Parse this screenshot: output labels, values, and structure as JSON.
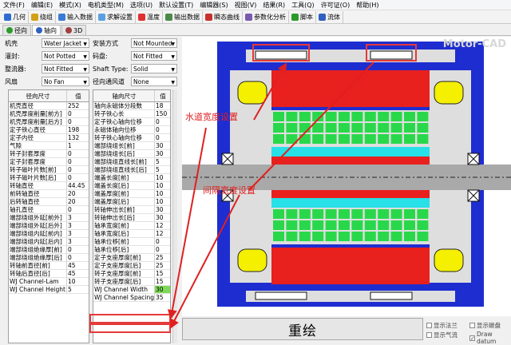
{
  "menu": [
    "文件(F)",
    "编辑(E)",
    "模式(X)",
    "电机类型(M)",
    "选项(U)",
    "默认设置(T)",
    "编辑器(S)",
    "视图(V)",
    "结果(R)",
    "工具(Q)",
    "许可证(O)",
    "帮助(H)"
  ],
  "toolbar": [
    {
      "label": "几何",
      "icon": "geometry-icon",
      "color": "#2e6bd0"
    },
    {
      "label": "绕组",
      "icon": "winding-icon",
      "color": "#d4a017"
    },
    {
      "label": "输入数据",
      "icon": "input-data-icon",
      "color": "#3a7bd5"
    },
    {
      "label": "求解设置",
      "icon": "solve-settings-icon",
      "color": "#5aa0e0"
    },
    {
      "label": "温度",
      "icon": "temperature-icon",
      "color": "#e03030"
    },
    {
      "label": "输出数据",
      "icon": "output-data-icon",
      "color": "#4a8a4a"
    },
    {
      "label": "瞬态曲线",
      "icon": "transient-curve-icon",
      "color": "#c83030"
    },
    {
      "label": "参数化分析",
      "icon": "sensitivity-icon",
      "color": "#7a5ab0"
    },
    {
      "label": "脚本",
      "icon": "script-icon",
      "color": "#2a9a2a"
    },
    {
      "label": "流体",
      "icon": "fluid-icon",
      "color": "#3060c0"
    }
  ],
  "subtabs": [
    {
      "label": "径向",
      "icon": "radial-icon"
    },
    {
      "label": "轴向",
      "icon": "axial-icon"
    },
    {
      "label": "3D",
      "icon": "3d-icon"
    }
  ],
  "form": {
    "housing_label": "机壳",
    "housing_value": "Water Jacket",
    "mount_label": "安装方式",
    "mount_value": "Not Mounted",
    "potting_label": "灌封:",
    "potting_value": "Not Potted",
    "encoder_label": "码盘:",
    "encoder_value": "Not Fitted",
    "comm_label": "整流器:",
    "comm_value": "Not Fitted",
    "shaft_label": "Shaft Type:",
    "shaft_value": "Solid",
    "fan_label": "风扇",
    "fan_value": "No Fan",
    "vent_label": "径向通风道",
    "vent_value": "None"
  },
  "radial_table": {
    "col_name": "径向尺寸",
    "col_value": "值",
    "rows": [
      [
        "机壳直径",
        "252"
      ],
      [
        "机壳厚度削量[前方]",
        "0"
      ],
      [
        "机壳厚度削量[后方]",
        "0"
      ],
      [
        "定子铁心直径",
        "198"
      ],
      [
        "定子内径",
        "132"
      ],
      [
        "气隙",
        "1"
      ],
      [
        "转子封套厚度",
        "0"
      ],
      [
        "定子封套厚度",
        "0"
      ],
      [
        "转子磁叶片数[前]",
        "0"
      ],
      [
        "转子磁叶片数[后]",
        "0"
      ],
      [
        "转轴直径",
        "44.45"
      ],
      [
        "前转轴直径",
        "20"
      ],
      [
        "后转轴直径",
        "20"
      ],
      [
        "轴孔直径",
        "0"
      ],
      [
        "端部绕组外延[前外]",
        "3"
      ],
      [
        "端部绕组外延[后外]",
        "3"
      ],
      [
        "端部绕组内延[前内]",
        "3"
      ],
      [
        "端部绕组内延[后内]",
        "3"
      ],
      [
        "端部绕组绝缘厚[前]",
        "0"
      ],
      [
        "端部绕组绝缘厚[后]",
        "0"
      ],
      [
        "转轴前直径[前]",
        "45"
      ],
      [
        "转轴后直径[后]",
        "45"
      ],
      [
        "WJ Channel-Lam",
        "10"
      ],
      [
        "WJ Channel Height",
        "5"
      ]
    ]
  },
  "axial_table": {
    "col_name": "轴向尺寸",
    "col_value": "值",
    "rows": [
      [
        "轴向永磁体分段数",
        "18"
      ],
      [
        "转子铁心长",
        "150"
      ],
      [
        "定子铁心轴向位移",
        "0"
      ],
      [
        "永磁体轴向位移",
        "0"
      ],
      [
        "转子铁心轴向位移",
        "0"
      ],
      [
        "端部绕组长[前]",
        "30"
      ],
      [
        "端部绕组长[后]",
        "30"
      ],
      [
        "端部绕组直线长[前]",
        "5"
      ],
      [
        "端部绕组直线长[后]",
        "5"
      ],
      [
        "端盖长度[前]",
        "10"
      ],
      [
        "端盖长度[后]",
        "10"
      ],
      [
        "端盖厚度[前]",
        "10"
      ],
      [
        "端盖厚度[后]",
        "10"
      ],
      [
        "转轴伸出长[前]",
        "30"
      ],
      [
        "转轴伸出长[后]",
        "30"
      ],
      [
        "轴承宽度[前]",
        "12"
      ],
      [
        "轴承宽度[后]",
        "12"
      ],
      [
        "轴承位移[前]",
        "0"
      ],
      [
        "轴承位移[后]",
        "0"
      ],
      [
        "定子支座厚度[前]",
        "25"
      ],
      [
        "定子支座厚度[后]",
        "25"
      ],
      [
        "转子支座厚度[前]",
        "15"
      ],
      [
        "转子支座厚度[后]",
        "15"
      ],
      [
        "WJ Channel Width",
        "30"
      ],
      [
        "WJ Channel Spacing",
        "35"
      ]
    ]
  },
  "redraw_label": "重绘",
  "checkboxes": [
    {
      "label": "显示法兰",
      "checked": false
    },
    {
      "label": "显示气流",
      "checked": false
    },
    {
      "label": "显示碳盘",
      "checked": false
    },
    {
      "label": "Draw datum",
      "checked": true
    }
  ],
  "watermark": "Motor-CAD",
  "annotations": {
    "channel_width": "水道宽度设置",
    "channel_spacing": "间隔宽度设置"
  },
  "colors": {
    "housing": "#1e2dd0",
    "stator_green": "#29d84a",
    "rotor_red": "#e8201e",
    "magnet_cyan": "#27e0e8",
    "endwinding_yellow": "#f4f000",
    "shaft_gray": "#a9a9a9",
    "annotation_red": "#e02020"
  }
}
